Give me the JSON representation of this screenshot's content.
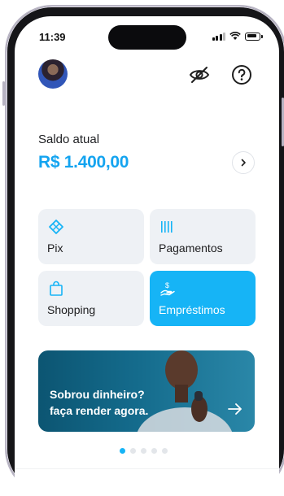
{
  "status_bar": {
    "time": "11:39"
  },
  "header": {
    "avatar_icon": "profile-avatar",
    "hide_balance_icon": "eye-off-icon",
    "help_icon": "help-circle-icon"
  },
  "balance": {
    "label": "Saldo atual",
    "value": "R$ 1.400,00",
    "details_icon": "chevron-right-icon"
  },
  "actions": [
    {
      "label": "Pix",
      "icon": "pix-icon",
      "active": false
    },
    {
      "label": "Pagamentos",
      "icon": "barcode-icon",
      "active": false
    },
    {
      "label": "Shopping",
      "icon": "shopping-bag-icon",
      "active": false
    },
    {
      "label": "Empréstimos",
      "icon": "loan-hand-icon",
      "active": true
    }
  ],
  "banner": {
    "line1": "Sobrou dinheiro?",
    "line2": "faça render agora.",
    "arrow_icon": "arrow-right-icon"
  },
  "carousel": {
    "current_page": 1,
    "total_pages": 5
  },
  "colors": {
    "accent": "#16b4f6",
    "balance": "#14a4f0",
    "tile_bg": "#eef1f5",
    "banner": "#0c5572"
  }
}
